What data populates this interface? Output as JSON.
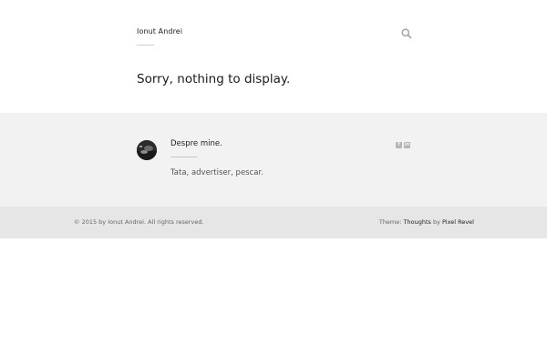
{
  "header": {
    "site_title": "Ionut Andrei",
    "search_icon": "search-icon"
  },
  "main": {
    "message": "Sorry, nothing to display."
  },
  "author": {
    "title": "Despre mine.",
    "bio": "Tata, advertiser, pescar.",
    "social_icons": [
      "facebook-icon",
      "linkedin-icon"
    ]
  },
  "footer": {
    "copyright": "© 2015 by Ionut Andrei. All rights reserved.",
    "theme_prefix": "Theme: ",
    "theme_name": "Thoughts",
    "by_text": " by ",
    "author_name": "Pixel Revel"
  },
  "colors": {
    "band_bg": "#f2f2f2",
    "footer_bg": "#e6e6e6"
  }
}
